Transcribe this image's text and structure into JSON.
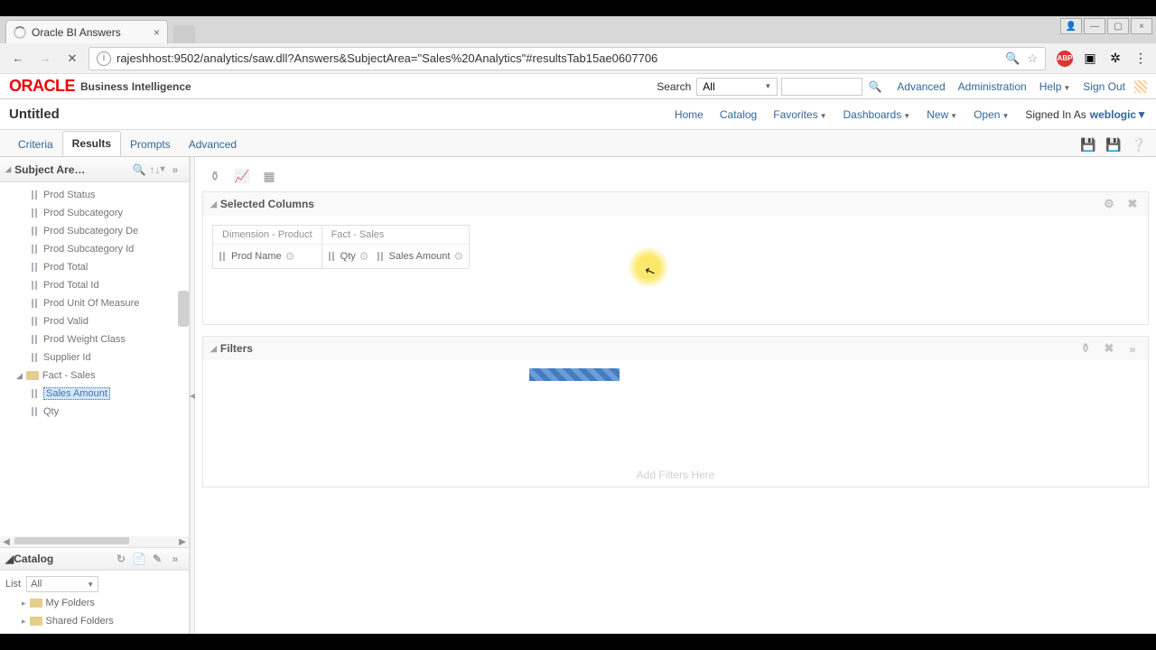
{
  "browser": {
    "tab_title": "Oracle BI Answers",
    "url": "rajeshhost:9502/analytics/saw.dll?Answers&SubjectArea=\"Sales%20Analytics\"#resultsTab15ae0607706"
  },
  "oracle_header": {
    "logo_text": "ORACLE",
    "product": "Business Intelligence",
    "search_label": "Search",
    "search_scope": "All",
    "links": {
      "advanced": "Advanced",
      "admin": "Administration",
      "help": "Help",
      "signout": "Sign Out"
    }
  },
  "subheader": {
    "doc_title": "Untitled",
    "links": {
      "home": "Home",
      "catalog": "Catalog",
      "favorites": "Favorites",
      "dashboards": "Dashboards",
      "new": "New",
      "open": "Open"
    },
    "signed_in_label": "Signed In As",
    "user": "weblogic"
  },
  "tabs": [
    {
      "label": "Criteria",
      "active": false
    },
    {
      "label": "Results",
      "active": true
    },
    {
      "label": "Prompts",
      "active": false
    },
    {
      "label": "Advanced",
      "active": false
    }
  ],
  "subject_area": {
    "title": "Subject Are…",
    "items": [
      "Prod Status",
      "Prod Subcategory",
      "Prod Subcategory De",
      "Prod Subcategory Id",
      "Prod Total",
      "Prod Total Id",
      "Prod Unit Of Measure",
      "Prod Valid",
      "Prod Weight Class",
      "Supplier Id"
    ],
    "fact_folder": "Fact - Sales",
    "fact_items": [
      "Sales Amount",
      "Qty"
    ]
  },
  "catalog": {
    "title": "Catalog",
    "list_label": "List",
    "list_value": "All",
    "folders": [
      "My Folders",
      "Shared Folders"
    ]
  },
  "selected_columns": {
    "title": "Selected Columns",
    "groups": [
      {
        "header": "Dimension - Product",
        "cols": [
          "Prod Name"
        ]
      },
      {
        "header": "Fact - Sales",
        "cols": [
          "Qty",
          "Sales Amount"
        ]
      }
    ]
  },
  "filters": {
    "title": "Filters",
    "placeholder": "Add Filters Here"
  }
}
